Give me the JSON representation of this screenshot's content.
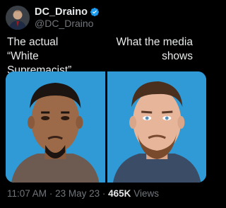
{
  "author": {
    "display_name": "DC_Draino",
    "handle": "@DC_Draino",
    "verified_icon": "verified-badge-icon",
    "accent": "#1d9bf0"
  },
  "captions": {
    "left": [
      "The actual",
      "“White Supremacist”"
    ],
    "right": [
      "What the media",
      "shows"
    ]
  },
  "images": {
    "background_color": "#2f9ad6"
  },
  "meta": {
    "time": "11:07 AM",
    "separator": "·",
    "date": "23 May 23",
    "views_count": "465K",
    "views_label": "Views"
  }
}
